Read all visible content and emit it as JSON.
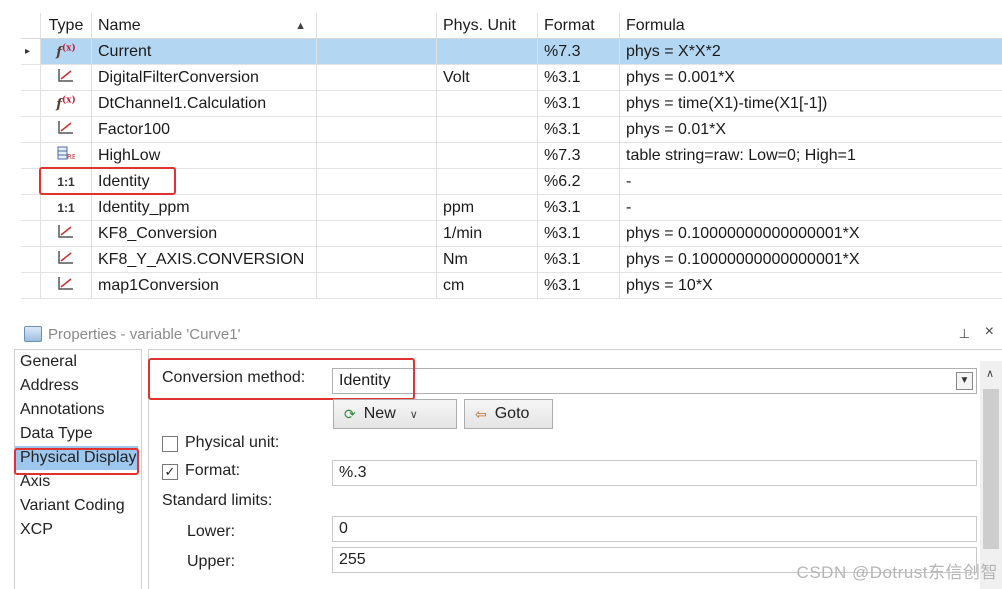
{
  "table": {
    "headers": {
      "type": "Type",
      "name": "Name",
      "unit": "Phys. Unit",
      "format": "Format",
      "formula": "Formula"
    },
    "rows": [
      {
        "icon": "formula-icon",
        "name": "Current",
        "unit": "",
        "format": "%7.3",
        "formula": "phys = X*X*2",
        "selected": true
      },
      {
        "icon": "curve-icon",
        "name": "DigitalFilterConversion",
        "unit": "Volt",
        "format": "%3.1",
        "formula": "phys = 0.001*X"
      },
      {
        "icon": "formula-icon",
        "name": "DtChannel1.Calculation",
        "unit": "",
        "format": "%3.1",
        "formula": "phys = time(X1)-time(X1[-1])"
      },
      {
        "icon": "curve-icon",
        "name": "Factor100",
        "unit": "",
        "format": "%3.1",
        "formula": "phys = 0.01*X"
      },
      {
        "icon": "table-icon",
        "name": "HighLow",
        "unit": "",
        "format": "%7.3",
        "formula": "table string=raw: Low=0; High=1"
      },
      {
        "icon": "identity-icon",
        "name": "Identity",
        "unit": "",
        "format": "%6.2",
        "formula": "-"
      },
      {
        "icon": "identity-icon",
        "name": "Identity_ppm",
        "unit": "ppm",
        "format": "%3.1",
        "formula": "-"
      },
      {
        "icon": "curve-icon",
        "name": "KF8_Conversion",
        "unit": "1/min",
        "format": "%3.1",
        "formula": "phys = 0.10000000000000001*X"
      },
      {
        "icon": "curve-icon",
        "name": "KF8_Y_AXIS.CONVERSION",
        "unit": "Nm",
        "format": "%3.1",
        "formula": "phys = 0.10000000000000001*X"
      },
      {
        "icon": "curve-icon",
        "name": "map1Conversion",
        "unit": "cm",
        "format": "%3.1",
        "formula": "phys = 10*X"
      }
    ]
  },
  "properties": {
    "title": "Properties - variable 'Curve1'",
    "pin": "⊥",
    "close": "×",
    "sidebar": [
      "General",
      "Address",
      "Annotations",
      "Data Type",
      "Physical Display",
      "Axis",
      "Variant Coding",
      "XCP"
    ],
    "active_index": 4,
    "conversion_label": "Conversion method:",
    "conversion_value": "Identity",
    "new_button": "New",
    "goto_button": "Goto",
    "physical_unit_label": "Physical unit:",
    "physical_unit_checked": false,
    "format_label": "Format:",
    "format_checked": true,
    "format_value": "%.3",
    "standard_limits_label": "Standard limits:",
    "lower_label": "Lower:",
    "lower_value": "0",
    "upper_label": "Upper:",
    "upper_value": "255"
  },
  "watermark": "CSDN @Dotrust东信创智"
}
